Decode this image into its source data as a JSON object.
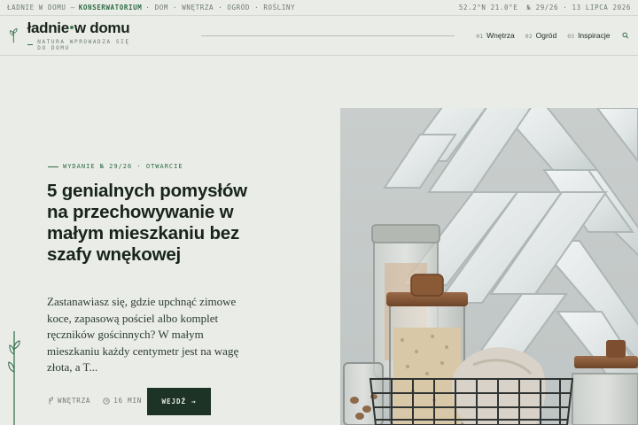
{
  "topbar": {
    "site": "ŁADNIE W DOMU —",
    "section": "KONSERWATORIUM",
    "categories": "· DOM · WNĘTRZA · OGRÓD · ROŚLINY",
    "coords": "52.2°N 21.0°E",
    "issue": "№ 29/26 · 13 LIPCA 2026"
  },
  "brand": {
    "name_part1": "ładnie",
    "name_part2": "w domu",
    "tagline": "NATURA WPROWADZA SIĘ DO DOMU"
  },
  "nav": [
    {
      "num": "01",
      "label": "Wnętrza"
    },
    {
      "num": "02",
      "label": "Ogród"
    },
    {
      "num": "03",
      "label": "Inspiracje"
    }
  ],
  "article": {
    "eyebrow": "WYDANIE № 29/26 · OTWARCIE",
    "headline": "5 genialnych pomysłów na przechowywanie w małym mieszkaniu bez szafy wnękowej",
    "excerpt": "Zastanawiasz się, gdzie upchnąć zimowe koce, zapasową pościel albo komplet ręczników gościnnych? W małym mieszkaniu każdy centymetr jest na wagę złota, a T...",
    "category": "WNĘTRZA",
    "read_time": "16 MIN",
    "cta_label": "WEJDŹ",
    "cta_arrow": "→"
  },
  "colors": {
    "background": "#e9ece7",
    "accent": "#2f6b45",
    "cta": "#1d3326"
  },
  "icons": [
    "sprout-logo-icon",
    "search-icon",
    "leaf-icon",
    "clock-icon",
    "sprout-decoration-icon"
  ]
}
